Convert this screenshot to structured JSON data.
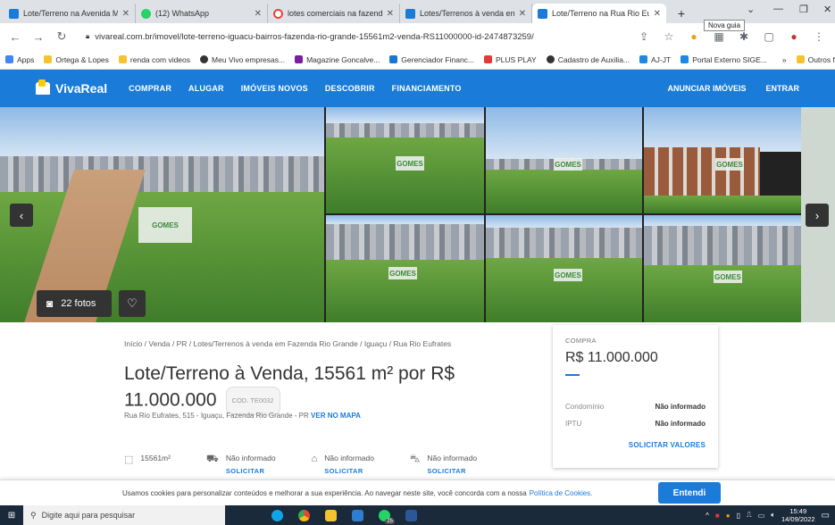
{
  "browser": {
    "tabs": [
      {
        "title": "Lote/Terreno na Avenida Mato ",
        "favicon_color": "#1a7bd9",
        "active": false
      },
      {
        "title": "(12) WhatsApp",
        "favicon_color": "#25d366",
        "active": false
      },
      {
        "title": "lotes comerciais na fazenda rio",
        "favicon_color": "#ea4335",
        "active": false
      },
      {
        "title": "Lotes/Terrenos à venda em Faz",
        "favicon_color": "#1a7bd9",
        "active": false
      },
      {
        "title": "Lote/Terreno na Rua Rio Eufrat",
        "favicon_color": "#1a7bd9",
        "active": true
      }
    ],
    "new_tab_tooltip": "Nova guia",
    "url": "vivareal.com.br/imovel/lote-terreno-iguacu-bairros-fazenda-rio-grande-15561m2-venda-RS11000000-id-2474873259/",
    "bookmarks": [
      {
        "label": "Apps",
        "color": "#4285f4"
      },
      {
        "label": "Ortega & Lopes",
        "color": "#f4c430"
      },
      {
        "label": "renda com videos",
        "color": "#f4c430"
      },
      {
        "label": "Meu Vivo empresas...",
        "color": "#333333"
      },
      {
        "label": "Magazine Goncalve...",
        "color": "#7b1fa2"
      },
      {
        "label": "Gerenciador Financ...",
        "color": "#1976d2"
      },
      {
        "label": "PLUS PLAY",
        "color": "#e53935"
      },
      {
        "label": "Cadastro de Auxilia...",
        "color": "#333333"
      },
      {
        "label": "AJ-JT",
        "color": "#1e88e5"
      },
      {
        "label": "Portal Externo SIGE...",
        "color": "#1e88e5"
      }
    ],
    "bookmarks_more": "»",
    "bookmarks_other": "Outros favoritos"
  },
  "site": {
    "logo": "VivaReal",
    "nav": [
      "COMPRAR",
      "ALUGAR",
      "IMÓVEIS NOVOS",
      "DESCOBRIR",
      "FINANCIAMENTO"
    ],
    "nav_right": [
      "ANUNCIAR IMÓVEIS",
      "ENTRAR"
    ]
  },
  "gallery": {
    "photo_count": "22 fotos",
    "sign_text": "GOMES"
  },
  "listing": {
    "breadcrumb": "Início / Venda / PR / Lotes/Terrenos à venda em Fazenda Rio Grande / Iguaçu / Rua Rio Eufrates",
    "title": "Lote/Terreno à Venda, 15561 m² por R$ 11.000.000",
    "code": "COD. TE0032",
    "address": "Rua Rio Eufrates, 515 - Iguaçu, Fazenda Rio Grande - PR",
    "map_link": "VER NO MAPA",
    "amenities": [
      {
        "icon": "area-icon",
        "label": "15561m²",
        "sub": ""
      },
      {
        "icon": "bed-icon",
        "label": "Não informado",
        "sub": "SOLICITAR"
      },
      {
        "icon": "shower-icon",
        "label": "Não informado",
        "sub": "SOLICITAR"
      },
      {
        "icon": "car-icon",
        "label": "Não informado",
        "sub": "SOLICITAR"
      }
    ]
  },
  "price_card": {
    "label": "COMPRA",
    "price": "R$ 11.000.000",
    "rows": [
      {
        "key": "Condomínio",
        "value": "Não informado"
      },
      {
        "key": "IPTU",
        "value": "Não informado"
      }
    ],
    "request": "SOLICITAR VALORES"
  },
  "cookie": {
    "text": "Usamos cookies para personalizar conteúdos e melhorar a sua experiência. Ao navegar neste site, você concorda com a nossa",
    "link": "Política de Cookies.",
    "button": "Entendi"
  },
  "taskbar": {
    "search_placeholder": "Digite aqui para pesquisar",
    "time": "15:49",
    "date": "14/09/2022",
    "whatsapp_badge": "25"
  }
}
